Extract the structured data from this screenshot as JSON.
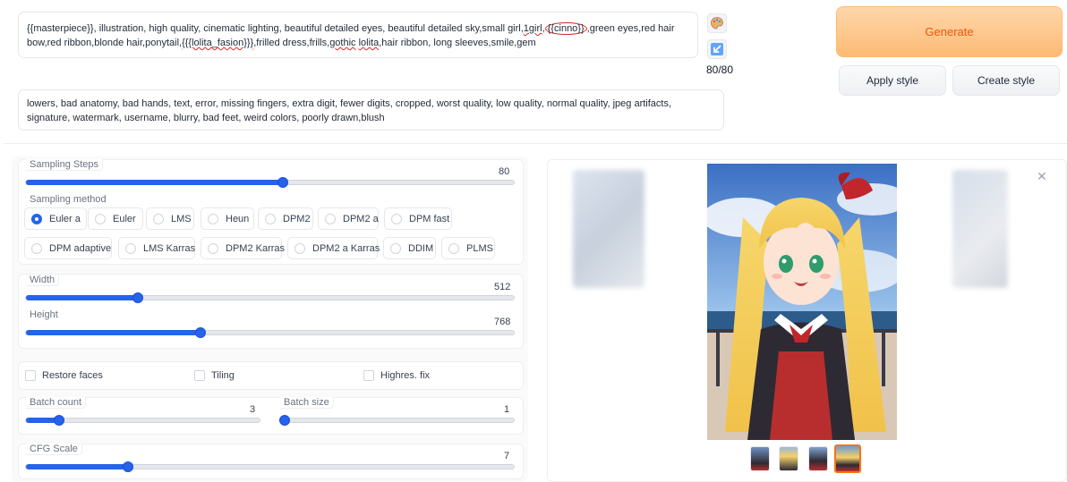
{
  "prompt": {
    "segments": [
      {
        "text": "{{masterpiece}}, illustration, high quality, cinematic lighting, beautiful detailed eyes, beautiful detailed sky,small girl,",
        "style": "plain"
      },
      {
        "text": "1girl",
        "style": "underline"
      },
      {
        "text": ",",
        "style": "plain"
      },
      {
        "text": "{{cinno}}",
        "style": "circled"
      },
      {
        "text": ",green eyes,red hair bow,red ribbon,blonde hair,ponytail,",
        "style": "plain"
      },
      {
        "text": "{{{lolita_fasion}}}",
        "style": "underline"
      },
      {
        "text": ",frilled dress,frills,",
        "style": "plain"
      },
      {
        "text": "gothic",
        "style": "underline"
      },
      {
        "text": " ",
        "style": "plain"
      },
      {
        "text": "lolita",
        "style": "underline"
      },
      {
        "text": ",hair ribbon, long sleeves,smile,gem",
        "style": "plain"
      }
    ]
  },
  "negative_prompt": "lowers, bad anatomy, bad hands, text, error, missing fingers, extra digit, fewer digits, cropped, worst quality, low quality, normal quality, jpeg artifacts, signature, watermark, username, blurry, bad feet, weird colors, poorly drawn,blush",
  "tools": {
    "paint_icon": "palette-icon",
    "arrow_icon": "arrow-down-left-icon"
  },
  "token_counter": "80/80",
  "buttons": {
    "generate": "Generate",
    "apply_style": "Apply style",
    "create_style": "Create style"
  },
  "sampling_steps": {
    "label": "Sampling Steps",
    "value": "80",
    "fraction": 0.526
  },
  "sampling_method": {
    "label": "Sampling method",
    "options": [
      "Euler a",
      "Euler",
      "LMS",
      "Heun",
      "DPM2",
      "DPM2 a",
      "DPM fast",
      "DPM adaptive",
      "LMS Karras",
      "DPM2 Karras",
      "DPM2 a Karras",
      "DDIM",
      "PLMS"
    ],
    "selected": "Euler a"
  },
  "width": {
    "label": "Width",
    "value": "512",
    "fraction": 0.23
  },
  "height": {
    "label": "Height",
    "value": "768",
    "fraction": 0.357
  },
  "checkboxes": {
    "restore_faces": "Restore faces",
    "tiling": "Tiling",
    "highres_fix": "Highres. fix"
  },
  "batch_count": {
    "label": "Batch count",
    "value": "3",
    "fraction": 0.143
  },
  "batch_size": {
    "label": "Batch size",
    "value": "1",
    "fraction": 0.0
  },
  "cfg_scale": {
    "label": "CFG Scale",
    "value": "7",
    "fraction": 0.21
  },
  "colors": {
    "accent": "#2563eb",
    "generate_text": "#ea580c",
    "generate_bg": "#fdba74",
    "selected_thumb": "#f97316"
  }
}
